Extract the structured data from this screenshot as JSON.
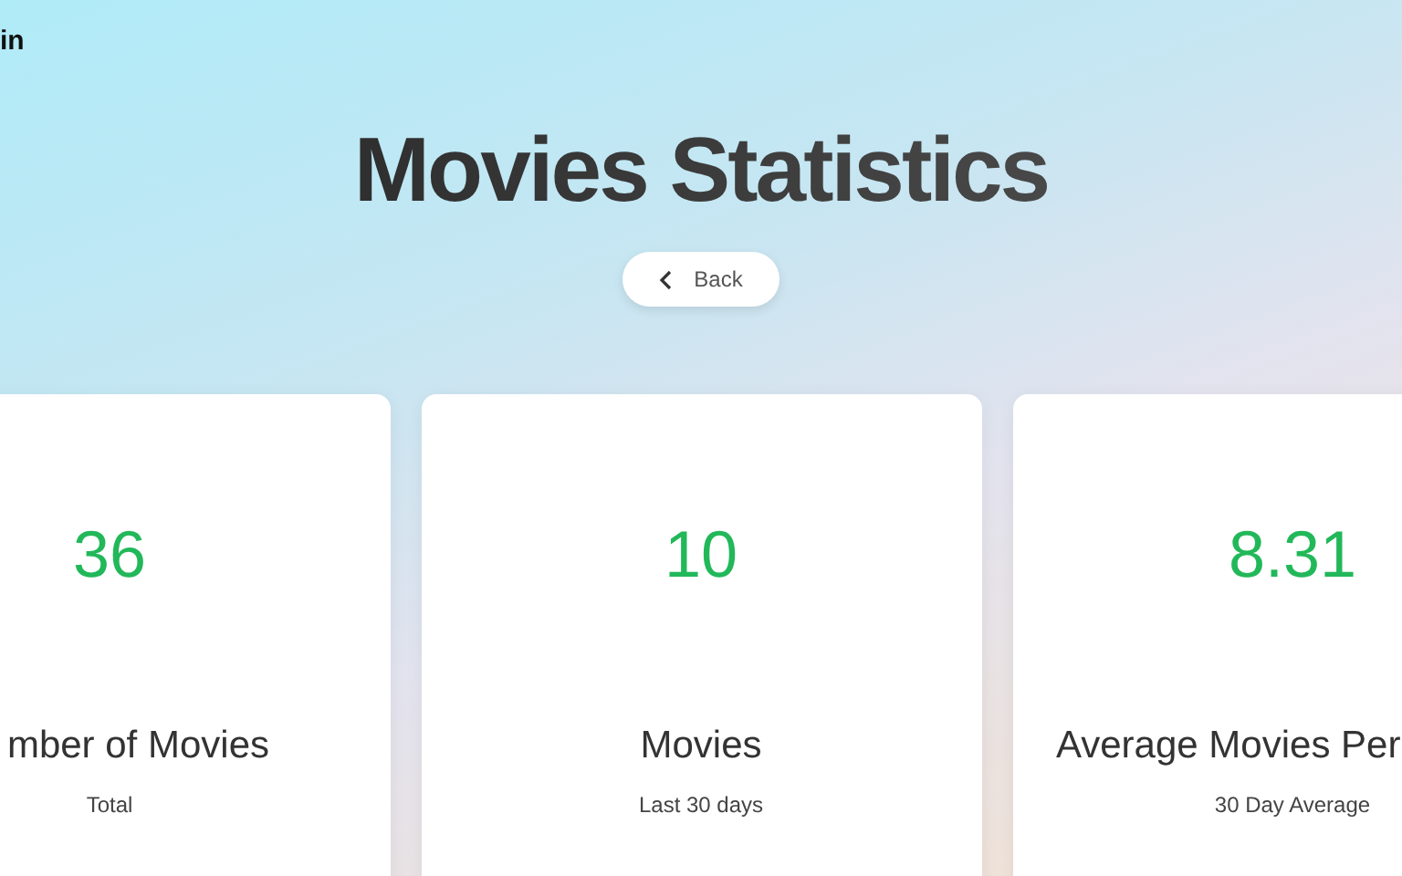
{
  "header": {
    "link": "in"
  },
  "title": "Movies Statistics",
  "back_button": {
    "label": "Back"
  },
  "cards": [
    {
      "value": "36",
      "label": "mber of Movies",
      "caption": "Total"
    },
    {
      "value": "10",
      "label": "Movies",
      "caption": "Last 30 days"
    },
    {
      "value": "8.31",
      "label": "Average Movies Per",
      "caption": "30 Day Average"
    }
  ]
}
